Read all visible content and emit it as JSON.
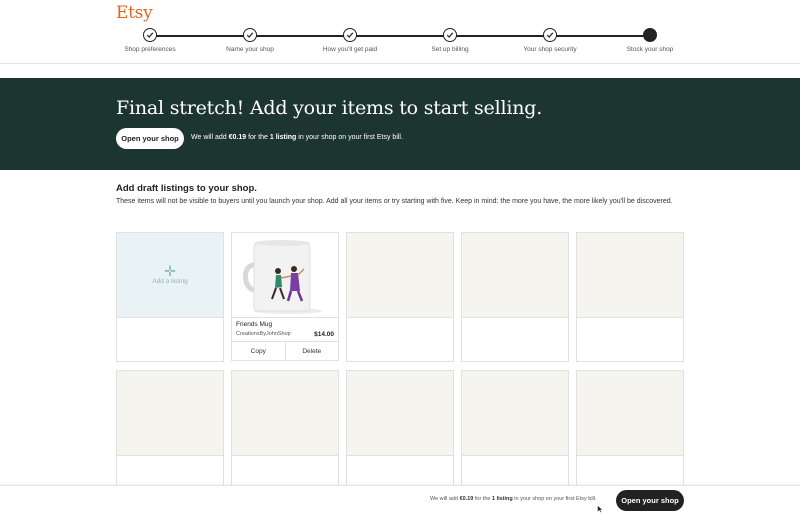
{
  "header": {
    "logo": "Etsy",
    "steps": [
      {
        "label": "Shop preferences",
        "status": "done"
      },
      {
        "label": "Name your shop",
        "status": "done"
      },
      {
        "label": "How you'll get paid",
        "status": "done"
      },
      {
        "label": "Set up billing",
        "status": "done"
      },
      {
        "label": "Your shop security",
        "status": "done"
      },
      {
        "label": "Stock your shop",
        "status": "current"
      }
    ]
  },
  "hero": {
    "title": "Final stretch! Add your items to start selling.",
    "open_button": "Open your shop",
    "note_prefix": "We will add ",
    "note_amount": "€0.19",
    "note_mid": " for the ",
    "note_count": "1 listing",
    "note_suffix": " in your shop on your first Etsy bill."
  },
  "drafts": {
    "title": "Add draft listings to your shop.",
    "description": "These items will not be visible to buyers until you launch your shop. Add all your items or try starting with five. Keep in mind: the more you have, the more likely you'll be discovered.",
    "add_label": "Add a listing",
    "listing": {
      "name": "Friends Mug",
      "shop": "CreationsByJohnShop",
      "price": "$14.00",
      "copy_label": "Copy",
      "delete_label": "Delete"
    }
  },
  "footer": {
    "note_prefix": "We will add ",
    "note_amount": "€0.19",
    "note_mid": " for the ",
    "note_count": "1 listing",
    "note_suffix": " in your shop on your first Etsy bill.",
    "open_button": "Open your shop"
  },
  "colors": {
    "brand": "#e0641d",
    "hero_bg": "#1d3530",
    "placeholder_bg": "#f6f4ef",
    "add_bg": "#e9f3f6"
  }
}
